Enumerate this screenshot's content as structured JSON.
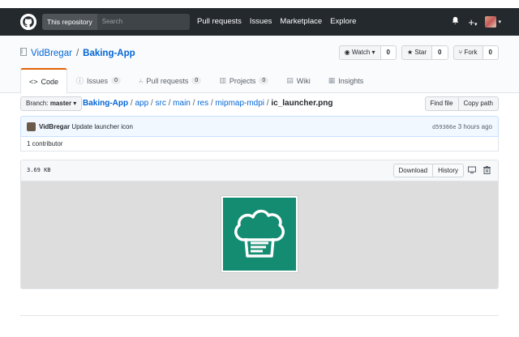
{
  "header": {
    "search_scope": "This repository",
    "search_placeholder": "Search",
    "nav": [
      "Pull requests",
      "Issues",
      "Marketplace",
      "Explore"
    ],
    "right_icons": [
      "bell-icon",
      "plus-icon",
      "avatar"
    ]
  },
  "repo": {
    "owner": "VidBregar",
    "separator": "/",
    "name": "Baking-App",
    "actions": {
      "watch_label": "Watch",
      "watch_count": "0",
      "star_label": "Star",
      "star_count": "0",
      "fork_label": "Fork",
      "fork_count": "0"
    },
    "tabs": [
      {
        "label": "Code",
        "icon": "code-icon",
        "count": ""
      },
      {
        "label": "Issues",
        "icon": "issue-icon",
        "count": "0"
      },
      {
        "label": "Pull requests",
        "icon": "pull-request-icon",
        "count": "0"
      },
      {
        "label": "Projects",
        "icon": "project-icon",
        "count": "0"
      },
      {
        "label": "Wiki",
        "icon": "book-icon",
        "count": ""
      },
      {
        "label": "Insights",
        "icon": "graph-icon",
        "count": ""
      }
    ]
  },
  "breadcrumb": {
    "branch_prefix": "Branch:",
    "branch": "master",
    "parts": [
      "Baking-App",
      "app",
      "src",
      "main",
      "res",
      "mipmap-mdpi"
    ],
    "file": "ic_launcher.png",
    "find_file": "Find file",
    "copy_path": "Copy path"
  },
  "commit": {
    "author": "VidBregar",
    "message": "Update launcher icon",
    "sha": "d59366e",
    "time": "3 hours ago",
    "contributors": "1 contributor"
  },
  "file": {
    "size": "3.69 KB",
    "download": "Download",
    "history": "History",
    "icons": [
      "desktop-icon",
      "trash-icon"
    ]
  },
  "colors": {
    "header_bg": "#24292e",
    "link": "#0366d6",
    "tab_accent": "#e36209",
    "icon_green": "#148c71"
  }
}
